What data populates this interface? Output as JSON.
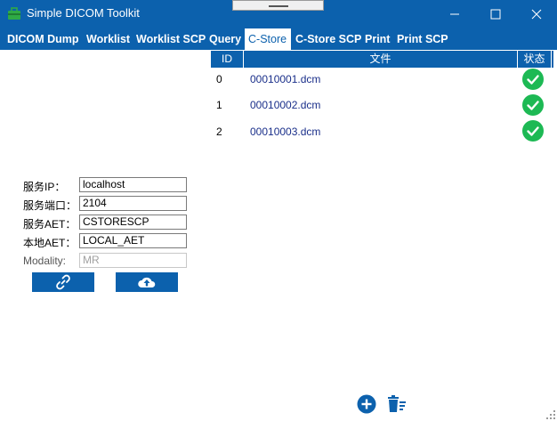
{
  "window": {
    "title": "Simple DICOM Toolkit",
    "colors": {
      "accent": "#0c61ad",
      "success": "#1db954",
      "file_text": "#1a2f8a"
    }
  },
  "tabs": [
    {
      "label": "DICOM Dump",
      "active": false
    },
    {
      "label": "Worklist",
      "active": false
    },
    {
      "label": "Worklist SCP",
      "active": false
    },
    {
      "label": "Query",
      "active": false
    },
    {
      "label": "C-Store",
      "active": true
    },
    {
      "label": "C-Store SCP",
      "active": false
    },
    {
      "label": "Print",
      "active": false
    },
    {
      "label": "Print SCP",
      "active": false
    }
  ],
  "grid": {
    "columns": [
      "ID",
      "文件",
      "状态"
    ],
    "rows": [
      {
        "id": "0",
        "file": "00010001.dcm",
        "status_icon": "check-circle-icon"
      },
      {
        "id": "1",
        "file": "00010002.dcm",
        "status_icon": "check-circle-icon"
      },
      {
        "id": "2",
        "file": "00010003.dcm",
        "status_icon": "check-circle-icon"
      }
    ]
  },
  "form": {
    "server_ip": {
      "label": "服务IP：",
      "value": "localhost"
    },
    "server_port": {
      "label": "服务端口：",
      "value": "2104"
    },
    "server_aet": {
      "label": "服务AET：",
      "value": "CSTORESCP"
    },
    "local_aet": {
      "label": "本地AET：",
      "value": "LOCAL_AET"
    },
    "modality": {
      "label": "Modality:",
      "value": "MR",
      "disabled": true
    }
  },
  "actions": {
    "connect_icon": "link-icon",
    "upload_icon": "cloud-upload-icon",
    "add_icon": "add-circle-icon",
    "clear_icon": "clear-list-icon"
  }
}
